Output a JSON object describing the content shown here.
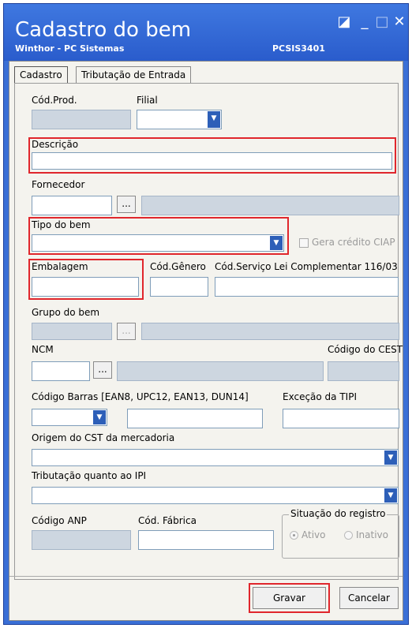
{
  "window": {
    "title": "Cadastro do bem",
    "subtitle": "Winthor - PC Sistemas",
    "code": "PCSIS3401"
  },
  "tabs": [
    {
      "label": "Cadastro",
      "active": true
    },
    {
      "label": "Tributação de Entrada",
      "active": false
    }
  ],
  "labels": {
    "cod_prod": "Cód.Prod.",
    "filial": "Filial",
    "descricao": "Descrição",
    "fornecedor": "Fornecedor",
    "tipo_do_bem": "Tipo do bem",
    "gera_credito": "Gera crédito CIAP",
    "embalagem": "Embalagem",
    "cod_genero": "Cód.Gênero",
    "cod_servico": "Cód.Serviço Lei Complementar 116/03",
    "grupo_do_bem": "Grupo do bem",
    "ncm": "NCM",
    "codigo_cest": "Código do CEST",
    "codigo_barras": "Código Barras [EAN8, UPC12, EAN13, DUN14]",
    "excecao_tipi": "Exceção da TIPI",
    "origem_cst": "Origem do CST da mercadoria",
    "tributacao_ipi": "Tributação quanto ao IPI",
    "codigo_anp": "Código ANP",
    "cod_fabrica": "Cód. Fábrica",
    "situacao": "Situação do registro",
    "ativo": "Ativo",
    "inativo": "Inativo"
  },
  "lookup_button": "...",
  "dropdown_arrow": "▼",
  "buttons": {
    "gravar": "Gravar",
    "cancelar": "Cancelar"
  },
  "colors": {
    "titlebar": "#2a5ccc",
    "highlight": "#e0262c"
  }
}
